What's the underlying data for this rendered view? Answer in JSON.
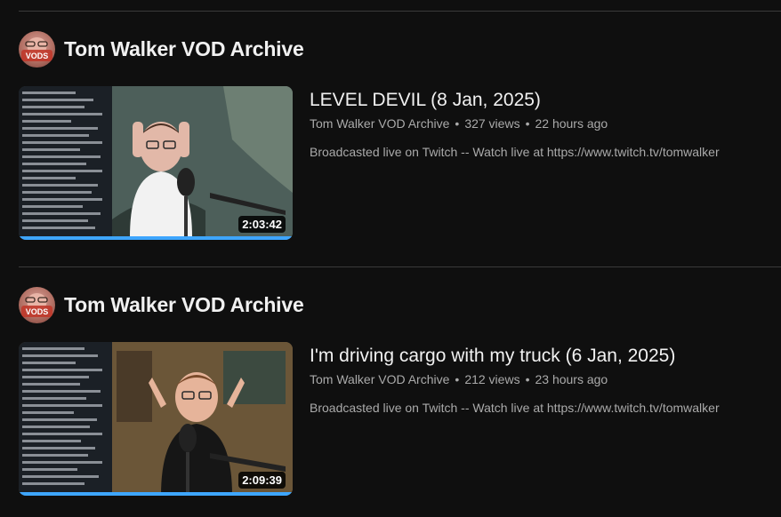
{
  "colors": {
    "background": "#0f0f0f",
    "text_primary": "#f1f1f1",
    "text_secondary": "#aaaaaa",
    "progress": "#3ea6ff",
    "divider": "#3a3a3a"
  },
  "sections": [
    {
      "channel": {
        "name": "Tom Walker VOD Archive",
        "avatar_text": "VODS",
        "avatar_icon": "channel-avatar"
      },
      "video": {
        "title": "LEVEL DEVIL (8 Jan, 2025)",
        "channel_name": "Tom Walker VOD Archive",
        "separator": "•",
        "views": "327 views",
        "age": "22 hours ago",
        "description": "Broadcasted live on Twitch -- Watch live at https://www.twitch.tv/tomwalker",
        "duration": "2:03:42",
        "watched_fraction": 1.0
      }
    },
    {
      "channel": {
        "name": "Tom Walker VOD Archive",
        "avatar_text": "VODS",
        "avatar_icon": "channel-avatar"
      },
      "video": {
        "title": "I'm driving cargo with my truck (6 Jan, 2025)",
        "channel_name": "Tom Walker VOD Archive",
        "separator": "•",
        "views": "212 views",
        "age": "23 hours ago",
        "description": "Broadcasted live on Twitch -- Watch live at https://www.twitch.tv/tomwalker",
        "duration": "2:09:39",
        "watched_fraction": 1.0
      }
    }
  ]
}
